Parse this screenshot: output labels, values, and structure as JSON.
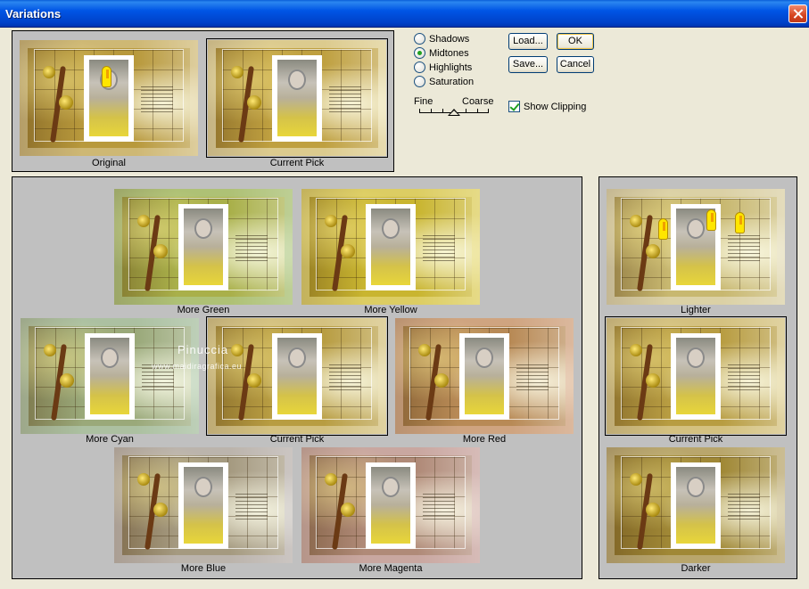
{
  "window": {
    "title": "Variations"
  },
  "top_panel": {
    "original_caption": "Original",
    "current_pick_caption": "Current Pick"
  },
  "range": {
    "options": [
      {
        "label": "Shadows",
        "selected": false
      },
      {
        "label": "Midtones",
        "selected": true
      },
      {
        "label": "Highlights",
        "selected": false
      },
      {
        "label": "Saturation",
        "selected": false
      }
    ]
  },
  "amount": {
    "fine_label": "Fine",
    "coarse_label": "Coarse",
    "value_fraction": 0.5
  },
  "show_clipping": {
    "label": "Show Clipping",
    "checked": true
  },
  "buttons": {
    "load": "Load...",
    "save": "Save...",
    "ok": "OK",
    "cancel": "Cancel"
  },
  "color_panel": {
    "captions": {
      "more_green": "More Green",
      "more_yellow": "More Yellow",
      "more_cyan": "More Cyan",
      "current_pick": "Current Pick",
      "more_red": "More Red",
      "more_blue": "More Blue",
      "more_magenta": "More Magenta"
    },
    "colors": {
      "more_green": "#a9b04a",
      "more_yellow": "#c9b530",
      "more_cyan": "#9aa97a",
      "current_pick": "#b89d42",
      "more_red": "#b88a56",
      "more_blue": "#a59a80",
      "more_magenta": "#b08a78"
    }
  },
  "brightness_panel": {
    "captions": {
      "lighter": "Lighter",
      "current_pick": "Current Pick",
      "darker": "Darker"
    }
  },
  "watermark": {
    "name": "Pinuccia",
    "site": "www.maidiragrafica.eu"
  }
}
